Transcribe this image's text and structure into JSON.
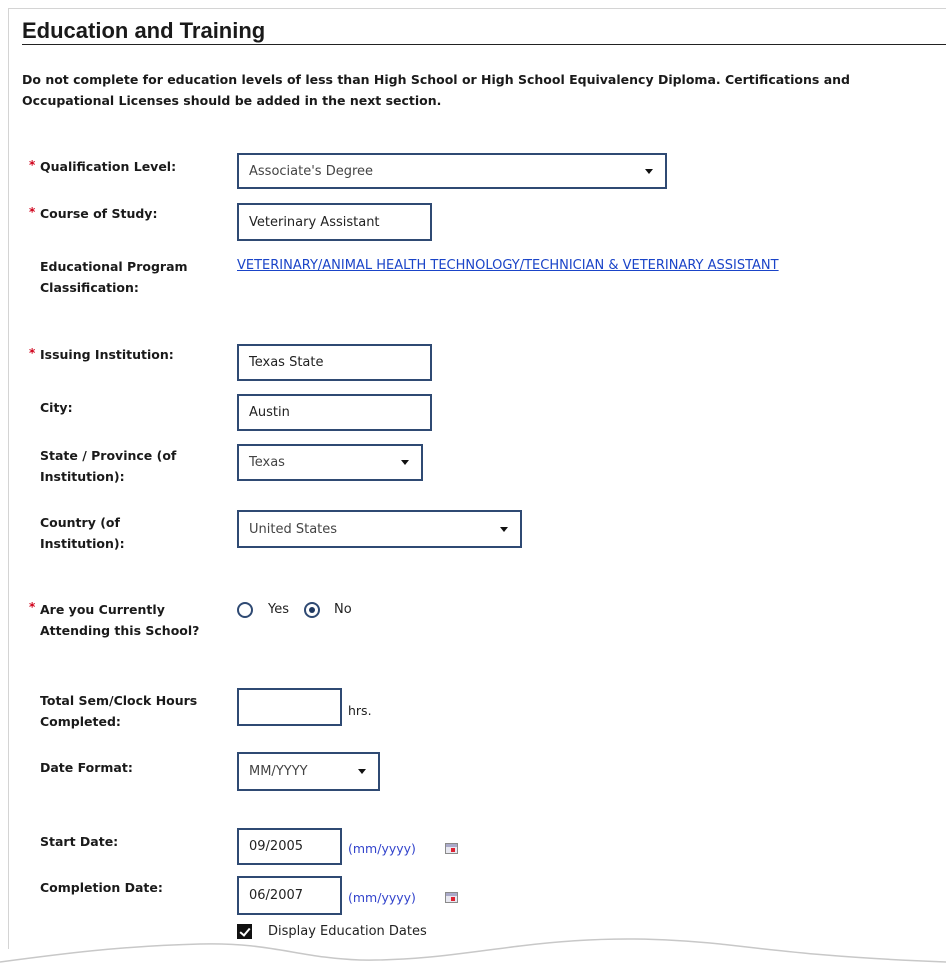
{
  "section": {
    "title": "Education and Training",
    "intro": "Do not complete for education levels of less than High School or High School Equivalency Diploma. Certifications and Occupational Licenses should be added in the next section."
  },
  "required_marker": "*",
  "fields": {
    "qualification_level": {
      "label": "Qualification Level:",
      "value": "Associate's Degree"
    },
    "course_of_study": {
      "label": "Course of Study:",
      "value": "Veterinary Assistant"
    },
    "program_classification": {
      "label_line1": "Educational Program",
      "label_line2": "Classification:",
      "link": "VETERINARY/ANIMAL HEALTH TECHNOLOGY/TECHNICIAN & VETERINARY ASSISTANT"
    },
    "issuing_institution": {
      "label": "Issuing Institution:",
      "value": "Texas State"
    },
    "city": {
      "label": "City:",
      "value": "Austin"
    },
    "state": {
      "label_line1": "State / Province (of",
      "label_line2": "Institution):",
      "value": "Texas"
    },
    "country": {
      "label_line1": "Country (of",
      "label_line2": "Institution):",
      "value": "United States"
    },
    "currently_attending": {
      "label_line1": "Are you Currently",
      "label_line2": "Attending this School?",
      "options": [
        "Yes",
        "No"
      ],
      "selected": "No"
    },
    "total_hours": {
      "label_line1": "Total Sem/Clock Hours",
      "label_line2": "Completed:",
      "value": "",
      "suffix": "hrs."
    },
    "date_format": {
      "label": "Date Format:",
      "value": "MM/YYYY"
    },
    "start_date": {
      "label": "Start Date:",
      "value": "09/2005",
      "hint": "(mm/yyyy)"
    },
    "completion_date": {
      "label": "Completion Date:",
      "value": "06/2007",
      "hint": "(mm/yyyy)"
    },
    "display_dates": {
      "label": "Display Education Dates",
      "checked": true
    }
  },
  "colors": {
    "required": "#d0021b",
    "field_border": "#2f4a73",
    "link": "#1a44c8",
    "hint": "#3344cc"
  }
}
